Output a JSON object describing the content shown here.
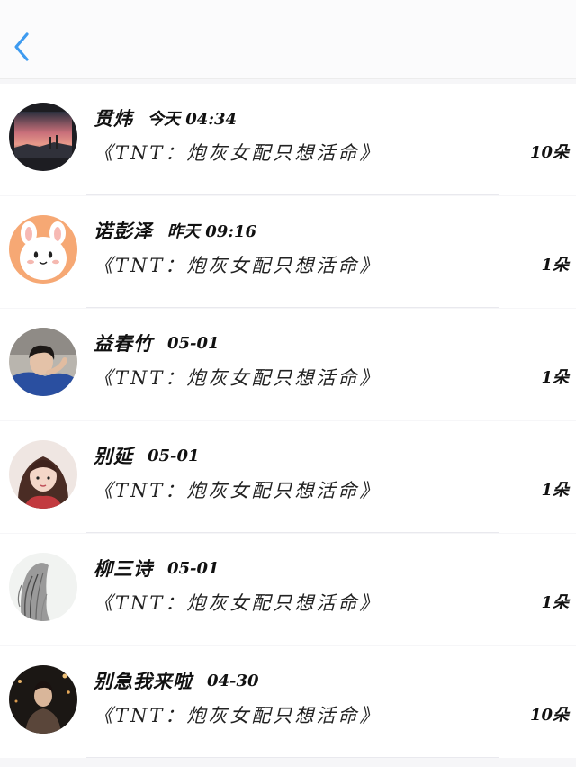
{
  "header": {
    "back_icon": "chevron-left-icon",
    "accent_color": "#3e9bf0"
  },
  "gifts": [
    {
      "name": "贯炜",
      "time": "今天 04:34",
      "book": "《TNT：炮灰女配只想活命》",
      "flowers": "10朵",
      "avatar": "sunset-avatar"
    },
    {
      "name": "诺彭泽",
      "time": "昨天 09:16",
      "book": "《TNT：炮灰女配只想活命》",
      "flowers": "1朵",
      "avatar": "bunny-avatar"
    },
    {
      "name": "益春竹",
      "time": "05-01",
      "book": "《TNT：炮灰女配只想活命》",
      "flowers": "1朵",
      "avatar": "boy-avatar"
    },
    {
      "name": "别延",
      "time": "05-01",
      "book": "《TNT：炮灰女配只想活命》",
      "flowers": "1朵",
      "avatar": "girl-avatar"
    },
    {
      "name": "柳三诗",
      "time": "05-01",
      "book": "《TNT：炮灰女配只想活命》",
      "flowers": "1朵",
      "avatar": "sketch-avatar"
    },
    {
      "name": "别急我来啦",
      "time": "04-30",
      "book": "《TNT：炮灰女配只想活命》",
      "flowers": "10朵",
      "avatar": "night-avatar"
    }
  ]
}
